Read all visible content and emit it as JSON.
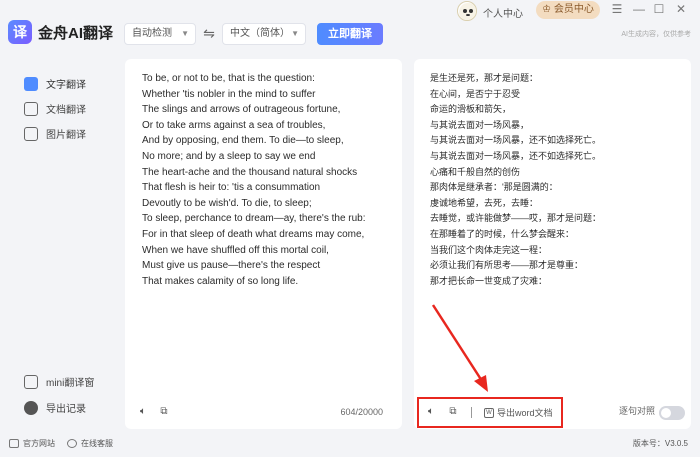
{
  "app": {
    "logo_char": "译",
    "name": "金舟AI翻译"
  },
  "toolbar": {
    "source_lang": "自动检测",
    "target_lang": "中文（简体）",
    "translate_button": "立即翻译",
    "swap_icon": "swap-arrows-icon"
  },
  "header": {
    "user_center": "个人中心",
    "member_center": "会员中心",
    "notice": "AI生成内容，仅供参考"
  },
  "sidebar": {
    "items": [
      {
        "label": "文字翻译",
        "icon": "text-translate-icon"
      },
      {
        "label": "文档翻译",
        "icon": "document-icon"
      },
      {
        "label": "图片翻译",
        "icon": "image-icon"
      }
    ],
    "bottom_items": [
      {
        "label": "mini翻译窗",
        "icon": "mini-window-icon"
      },
      {
        "label": "导出记录",
        "icon": "clock-icon"
      }
    ]
  },
  "source_text": {
    "lines": [
      "To be, or not to be, that is the question:",
      "Whether 'tis nobler in the mind to suffer",
      "The slings and arrows of outrageous fortune,",
      "Or to take arms against a sea of troubles,",
      "And by opposing, end them. To die—to sleep,",
      "No more; and by a sleep to say we end",
      "The heart-ache and the thousand natural shocks",
      "That flesh is heir to: 'tis a consummation",
      "Devoutly to be wish'd. To die, to sleep;",
      "To sleep, perchance to dream—ay, there's the rub:",
      "For in that sleep of death what dreams may come,",
      "When we have shuffled off this mortal coil,",
      "Must give us pause—there's the respect",
      "That makes calamity of so long life."
    ],
    "char_count": "604/20000"
  },
  "translated_text": {
    "lines": [
      "是生还是死，那才是问题：",
      "在心间，是否宁于忍受",
      "命运的滑板和箭矢，",
      "与其说去面对一场风暴，",
      "与其说去面对一场风暴，还不如选择死亡。",
      "与其说去面对一场风暴，还不如选择死亡。",
      "心痛和千般自然的创伤",
      "那肉体是继承者：'那是圆满的：",
      "虔诚地希望，去死，去睡：",
      "去睡觉，或许能做梦——哎，那才是问题：",
      "在那睡着了的时候，什么梦会醒来：",
      "当我们这个肉体走完这一程：",
      "必须让我们有所思考——那才是尊重：",
      "那才把长命一世变成了灾难："
    ],
    "export_word": "导出word文档",
    "sentence_compare": "逐句对照"
  },
  "footer": {
    "official_site": "官方网站",
    "online_service": "在线客服",
    "version": "版本号：V3.0.5"
  },
  "colors": {
    "accent": "#4f8cff",
    "highlight": "#e8271f",
    "member": "#f3dcc0"
  }
}
